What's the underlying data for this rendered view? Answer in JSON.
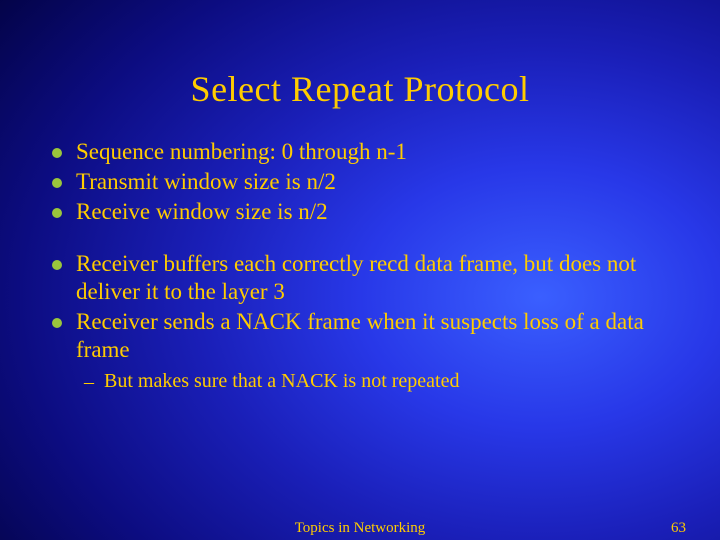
{
  "title": "Select Repeat Protocol",
  "groups": [
    {
      "items": [
        {
          "text": "Sequence numbering: 0 through n-1"
        },
        {
          "text": "Transmit window size is n/2"
        },
        {
          "text": "Receive window size is n/2"
        }
      ]
    },
    {
      "items": [
        {
          "text": "Receiver buffers each correctly recd data frame, but does not deliver it to the layer 3"
        },
        {
          "text": "Receiver sends a NACK frame when it suspects loss of a data frame",
          "sub": [
            "But makes sure that a NACK is not repeated"
          ]
        }
      ]
    }
  ],
  "footer": {
    "center": "Topics in Networking",
    "page": "63"
  }
}
